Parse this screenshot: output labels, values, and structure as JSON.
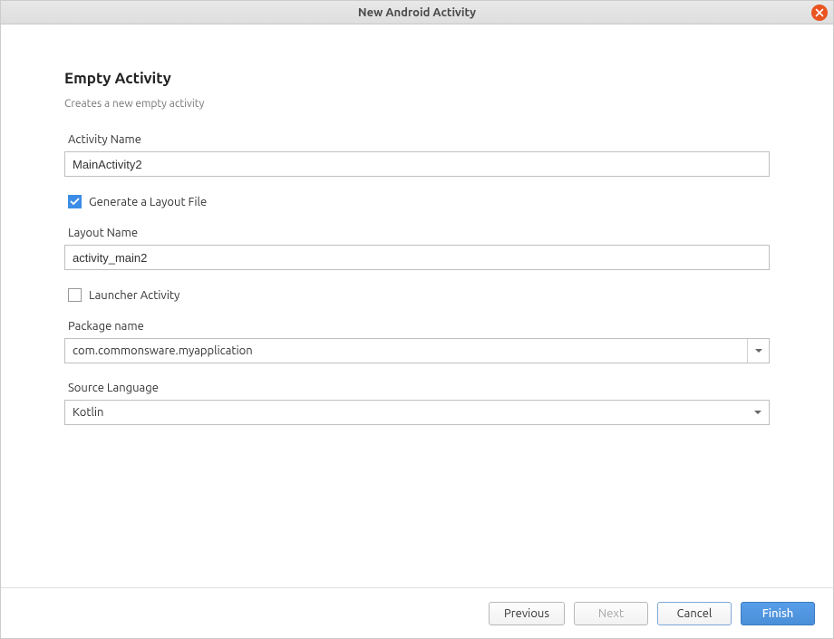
{
  "window": {
    "title": "New Android Activity"
  },
  "header": {
    "title": "Empty Activity",
    "subtitle": "Creates a new empty activity"
  },
  "fields": {
    "activity_name": {
      "label": "Activity Name",
      "value": "MainActivity2"
    },
    "generate_layout": {
      "label": "Generate a Layout File",
      "checked": true
    },
    "layout_name": {
      "label": "Layout Name",
      "value": "activity_main2"
    },
    "launcher_activity": {
      "label": "Launcher Activity",
      "checked": false
    },
    "package_name": {
      "label": "Package name",
      "value": "com.commonsware.myapplication"
    },
    "source_language": {
      "label": "Source Language",
      "value": "Kotlin"
    }
  },
  "buttons": {
    "previous": "Previous",
    "next": "Next",
    "cancel": "Cancel",
    "finish": "Finish"
  }
}
